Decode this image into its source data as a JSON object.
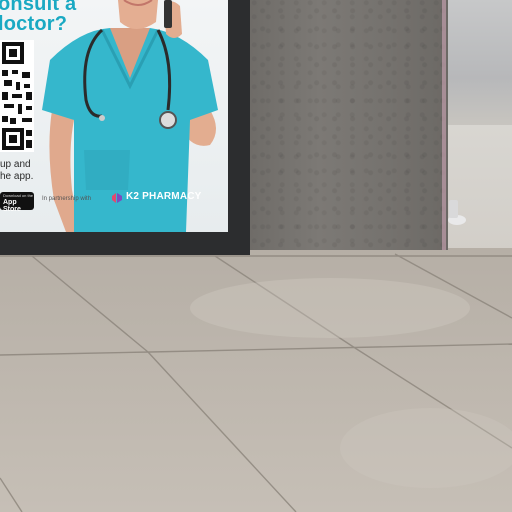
{
  "poster": {
    "headline_line1": "onsult a",
    "headline_line2": "loctor?",
    "side_line1": "up and",
    "side_line2": "he app.",
    "store_badge_small": "Download on the",
    "store_badge_big": "App Store",
    "partner_text": "In partnership with",
    "brand": "K2 PHARMACY"
  },
  "colors": {
    "headline": "#1aa9c3",
    "scrubs": "#35b7cc",
    "pillar": "#777470",
    "floor": "#bbb4ab"
  }
}
